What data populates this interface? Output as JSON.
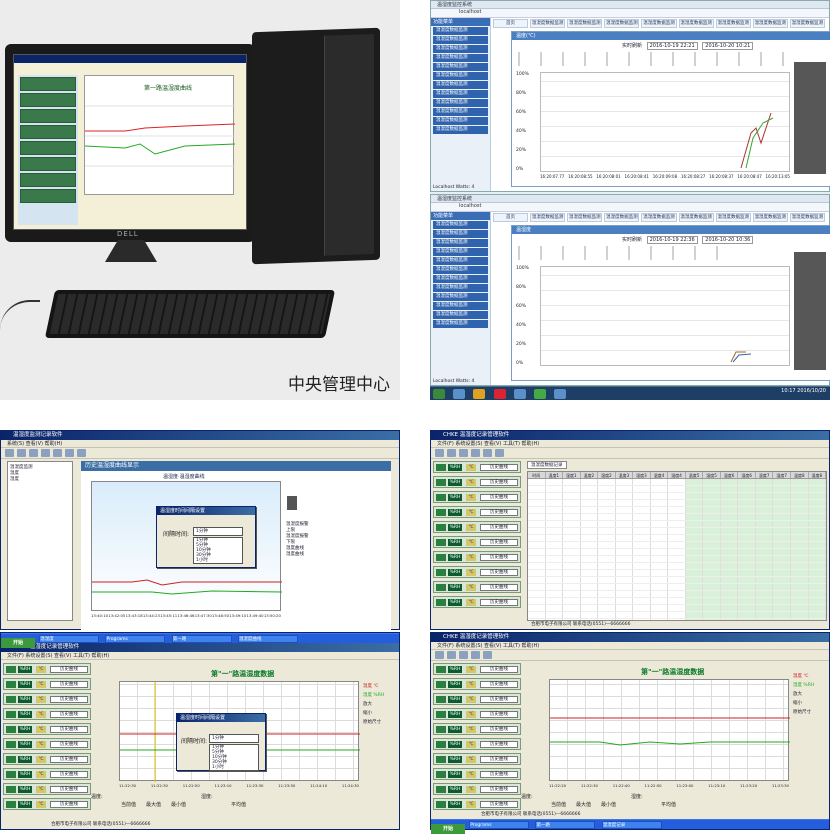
{
  "q1": {
    "caption": "中央管理中心",
    "brand": "DELL",
    "mini_title": "第一路温湿度曲线"
  },
  "q2": {
    "win1": {
      "title": "温湿度监控系统",
      "address": "localhost",
      "sidebar_header": "功能菜单",
      "panel_title": "温度(℃)",
      "query_label": "实时刷新",
      "dt_from": "2016-10-19 22:21",
      "dt_to": "2016-10-20 10:21",
      "yaxis": [
        "100%",
        "80%",
        "60%",
        "40%",
        "20%",
        "0%"
      ],
      "xticks": [
        "16:20:07.77",
        "16:20:08:55",
        "16:20:08:01",
        "16:20:08:41",
        "16:20:09:08",
        "16:20:08:27",
        "16:20:08:37",
        "16:20:08:47",
        "16:20:13:05"
      ],
      "footer": "Localhost Watts: 4"
    },
    "win2": {
      "title": "温湿度监控系统",
      "address": "localhost",
      "sidebar_header": "功能菜单",
      "panel_title": "温湿度",
      "query_label": "实时刷新",
      "dt_from": "2016-10-19 22:36",
      "dt_to": "2016-10-20 10:36",
      "yaxis": [
        "100%",
        "80%",
        "60%",
        "40%",
        "20%",
        "0%"
      ],
      "footer": "Localhost Watts: 4"
    },
    "sidebar_items": [
      "温湿度数据监测",
      "温湿度数据监测",
      "温湿度数据监测",
      "温湿度数据监测",
      "温湿度数据监测",
      "温湿度数据监测",
      "温湿度数据监测",
      "温湿度数据监测",
      "温湿度数据监测",
      "温湿度数据监测",
      "温湿度数据监测",
      "温湿度数据监测"
    ],
    "tabs": [
      "首页",
      "温湿度数据监测",
      "温湿度数据监测",
      "温湿度数据监测",
      "温湿度数据监测",
      "温湿度数据监测",
      "温湿度数据监测",
      "温湿度数据监测",
      "温湿度数据监测"
    ],
    "clock": "10:17 2016/10/20"
  },
  "q3": {
    "win_title": "温湿度监测记录软件",
    "menu": "系统(S)  查看(V)  帮助(H)",
    "panel_title": "历史温湿度曲线显示",
    "subtitle": "温湿度·温湿度曲线",
    "dialog_title": "温湿度时间间隔设置",
    "dialog_label": "间隔时间:",
    "dialog_value": "1分钟",
    "dialog_options": [
      "1分钟",
      "5分钟",
      "10分钟",
      "30分钟",
      "1小时"
    ],
    "side_opts": [
      "温湿度报警上限",
      "温湿度报警下限",
      "温度曲线",
      "湿度曲线"
    ],
    "xticks": [
      "13:40:10",
      "13:42:05",
      "13:43:18",
      "13:44:23",
      "13:45:11",
      "13:46:46",
      "13:47:30",
      "13:48:50",
      "13:49:10",
      "13:49:40",
      "13:50:20"
    ],
    "tree": [
      "温湿度监测",
      "温度",
      "湿度"
    ],
    "taskbar": [
      "开始",
      "温湿度",
      "Programs",
      "第一路",
      "温湿度曲线",
      "温湿度记录"
    ]
  },
  "q3b": {
    "win_title": "CHKE 温湿度记录管理软件",
    "menu": "文件(F)  系统设置(S)  查看(V)  工具(T)  帮助(H)",
    "chart_title": "第\"一\"路温湿度数据",
    "dialog_title": "温湿度时间间隔设置",
    "dialog_label": "间隔时间:",
    "dialog_value": "1分钟",
    "legend": [
      "温度 ℃",
      "湿度 %RH",
      "放大",
      "缩小",
      "原始尺寸"
    ],
    "chan_value": "%RH",
    "chan_unit": "℃",
    "chan_btn": "历史曲线",
    "stats_labels": [
      "温度:",
      "湿度:",
      "当前值",
      "最大值",
      "最小值",
      "平均值"
    ],
    "xticks": [
      "11:22:30",
      "11:22:30",
      "11:22:50",
      "11:23:10",
      "11:23:30",
      "11:23:50",
      "11:24:10",
      "11:24:30"
    ],
    "status": "合肥市电子有限公司  联系电话(0551)—6666666"
  },
  "q4": {
    "win_title": "CHKE 温湿度记录管理软件",
    "menu": "文件(F)  系统设置(S)  查看(V)  工具(T)  帮助(H)",
    "tab": "温湿度数据记录",
    "col_headers": [
      "时间",
      "温度1",
      "湿度1",
      "温度2",
      "湿度2",
      "温度3",
      "湿度3",
      "温度4",
      "湿度4",
      "温度5",
      "湿度5",
      "温度6",
      "湿度6",
      "温度7",
      "湿度7",
      "温度8",
      "湿度8"
    ],
    "status": "合肥市电子有限公司  联系电话(0551)—6666666",
    "row_count": "25"
  },
  "q4b": {
    "win_title": "CHKE 温湿度记录管理软件",
    "chart_title": "第\"一\"路温湿度数据",
    "legend": [
      "温度 ℃",
      "湿度 %RH",
      "放大",
      "缩小",
      "原始尺寸"
    ],
    "stats_labels": [
      "温度:",
      "湿度:",
      "当前值",
      "最大值",
      "最小值",
      "平均值"
    ],
    "xticks": [
      "11:22:20",
      "11:22:30",
      "11:22:40",
      "11:22:50",
      "11:23:00",
      "11:23:10",
      "11:23:20",
      "11:23:30"
    ],
    "status": "合肥市电子有限公司  联系电话(0551)—6666666"
  }
}
